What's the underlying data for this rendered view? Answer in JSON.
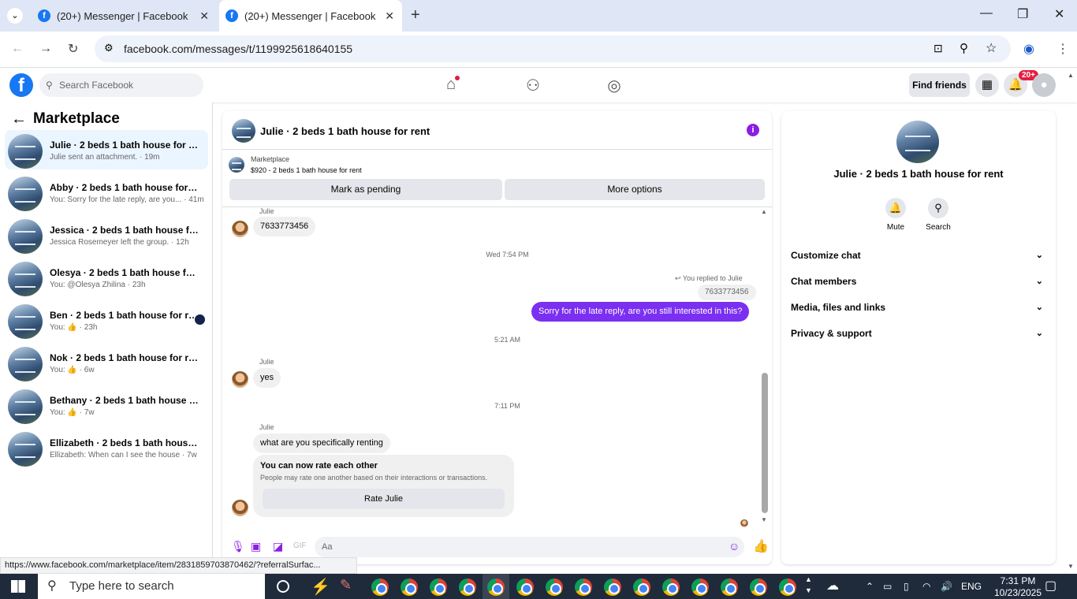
{
  "browser": {
    "tabs": [
      {
        "title": "(20+) Messenger | Facebook"
      },
      {
        "title": "(20+) Messenger | Facebook"
      }
    ],
    "url": "facebook.com/messages/t/1199925618640155",
    "status_url": "https://www.facebook.com/marketplace/item/2831859703870462/?referralSurfac..."
  },
  "fb": {
    "search_placeholder": "Search Facebook",
    "find_friends": "Find friends",
    "notif_badge": "20+"
  },
  "left": {
    "title": "Marketplace",
    "conversations": [
      {
        "name": "Julie · 2 beds 1 bath house for rent",
        "preview": "Julie sent an attachment. · 19m",
        "selected": true
      },
      {
        "name": "Abby · 2 beds 1 bath house for rent",
        "preview": "You: Sorry for the late reply, are you... · 41m"
      },
      {
        "name": "Jessica · 2 beds 1 bath house for re...",
        "preview": "Jessica Rosemeyer left the group. · 12h"
      },
      {
        "name": "Olesya · 2 beds 1 bath house for rent",
        "preview": "You: @Olesya Zhilina · 23h"
      },
      {
        "name": "Ben · 2 beds 1 bath house for rent",
        "preview": "You: 👍 · 23h",
        "unread": true
      },
      {
        "name": "Nok · 2 beds 1 bath house for rent",
        "preview": "You: 👍 · 6w"
      },
      {
        "name": "Bethany · 2 beds 1 bath house for r...",
        "preview": "You: 👍 · 7w"
      },
      {
        "name": "Ellizabeth · 2 beds 1 bath house fo...",
        "preview": "Ellizabeth: When can I see the house · 7w"
      }
    ]
  },
  "chat": {
    "title": "Julie · 2 beds 1 bath house for rent",
    "marketplace_label": "Marketplace",
    "listing": "$920 - 2 beds 1 bath house for rent",
    "mark_pending": "Mark as pending",
    "more_options": "More options",
    "messages": {
      "sender1": "Julie",
      "msg_phone": "7633773456",
      "time1": "Wed 7:54 PM",
      "replied_to": "You replied to Julie",
      "quoted": "7633773456",
      "my_msg": "Sorry for the late reply, are you still interested in this?",
      "time2": "5:21 AM",
      "sender2": "Julie",
      "msg_yes": "yes",
      "time3": "7:11 PM",
      "sender3": "Julie",
      "msg_renting": "what are you specifically renting",
      "rate_title": "You can now rate each other",
      "rate_sub": "People may rate one another based on their interactions or transactions.",
      "rate_btn": "Rate Julie"
    },
    "composer_placeholder": "Aa"
  },
  "right": {
    "name": "Julie · 2 beds 1 bath house for rent",
    "mute": "Mute",
    "search": "Search",
    "sections": [
      "Customize chat",
      "Chat members",
      "Media, files and links",
      "Privacy & support"
    ]
  },
  "taskbar": {
    "search_placeholder": "Type here to search",
    "lang": "ENG",
    "time": "7:31 PM",
    "date": "10/23/2025"
  },
  "colors": {
    "accent": "#7b2ff0",
    "fb_blue": "#1877f2"
  }
}
